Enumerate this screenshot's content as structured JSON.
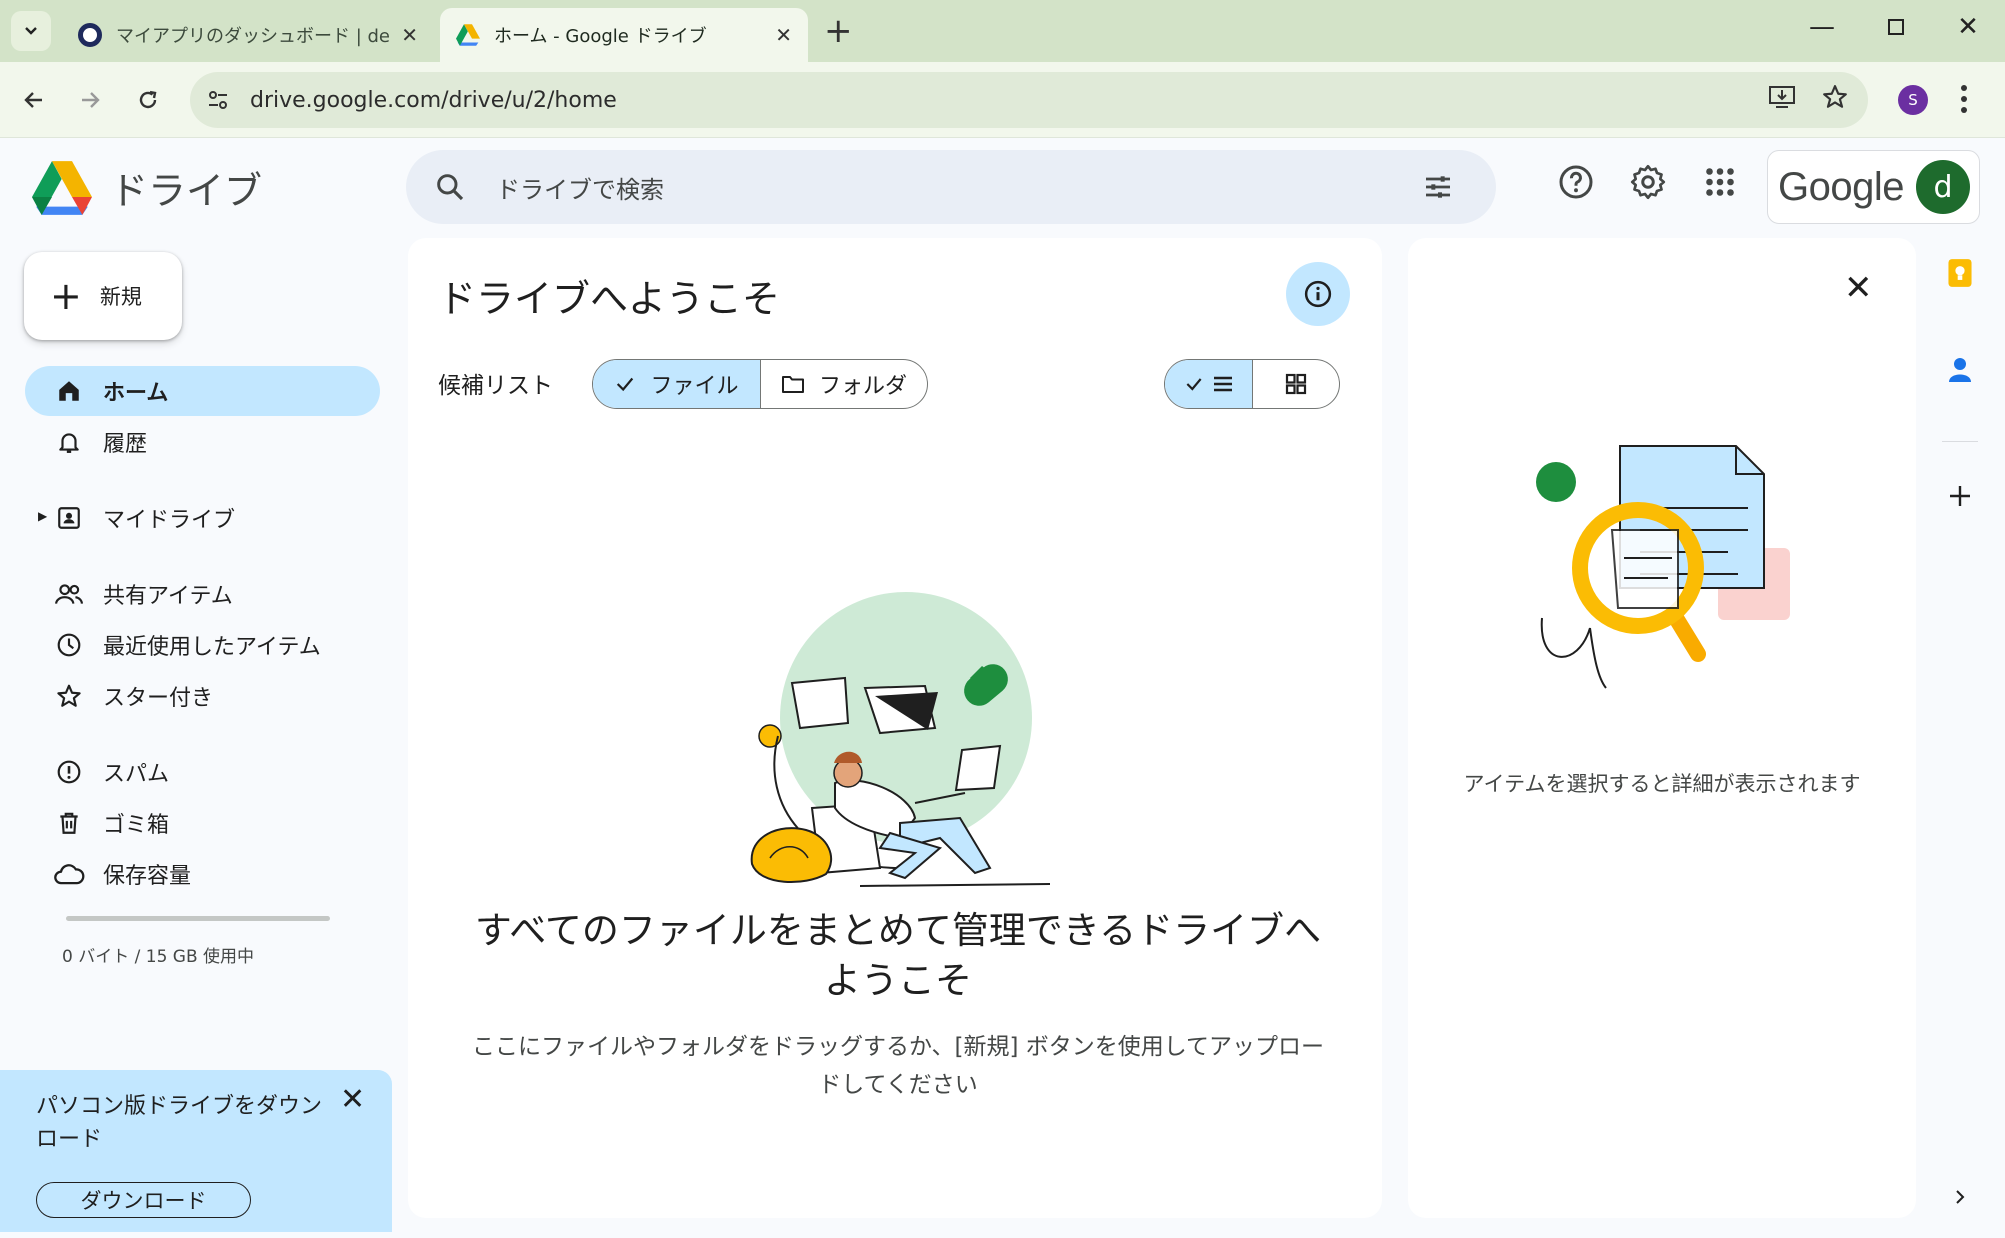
{
  "browser": {
    "tabs": [
      {
        "title": "マイアプリのダッシュボード | demo-o",
        "active": false
      },
      {
        "title": "ホーム - Google ドライブ",
        "active": true
      }
    ],
    "url": "drive.google.com/drive/u/2/home",
    "profile_initial": "S"
  },
  "header": {
    "product_name": "ドライブ",
    "search_placeholder": "ドライブで検索",
    "google_wordmark": "Google",
    "avatar_initial": "d"
  },
  "sidebar": {
    "new_label": "新規",
    "items": [
      {
        "label": "ホーム",
        "icon": "home-icon",
        "active": true
      },
      {
        "label": "履歴",
        "icon": "bell-icon"
      },
      {
        "label": "マイドライブ",
        "icon": "drive-folder-icon"
      },
      {
        "label": "共有アイテム",
        "icon": "people-icon"
      },
      {
        "label": "最近使用したアイテム",
        "icon": "clock-icon"
      },
      {
        "label": "スター付き",
        "icon": "star-icon"
      },
      {
        "label": "スパム",
        "icon": "spam-icon"
      },
      {
        "label": "ゴミ箱",
        "icon": "trash-icon"
      },
      {
        "label": "保存容量",
        "icon": "cloud-icon"
      }
    ],
    "storage_text": "0 バイト / 15 GB 使用中",
    "storage_used_fraction": 0.0,
    "download_banner": {
      "text": "パソコン版ドライブをダウンロード",
      "button": "ダウンロード"
    }
  },
  "main": {
    "title": "ドライブへようこそ",
    "suggestion_label": "候補リスト",
    "filter_files": "ファイル",
    "filter_folders": "フォルダ",
    "empty_title": "すべてのファイルをまとめて管理できるドライブへようこそ",
    "empty_subtitle": "ここにファイルやフォルダをドラッグするか、[新規] ボタンを使用してアップロードしてください"
  },
  "details": {
    "message": "アイテムを選択すると詳細が表示されます"
  },
  "colors": {
    "accent_light": "#c2e7ff",
    "page_bg": "#f8fafd",
    "chrome_tabbar": "#d3e3c8",
    "avatar": "#1e6b2d"
  }
}
